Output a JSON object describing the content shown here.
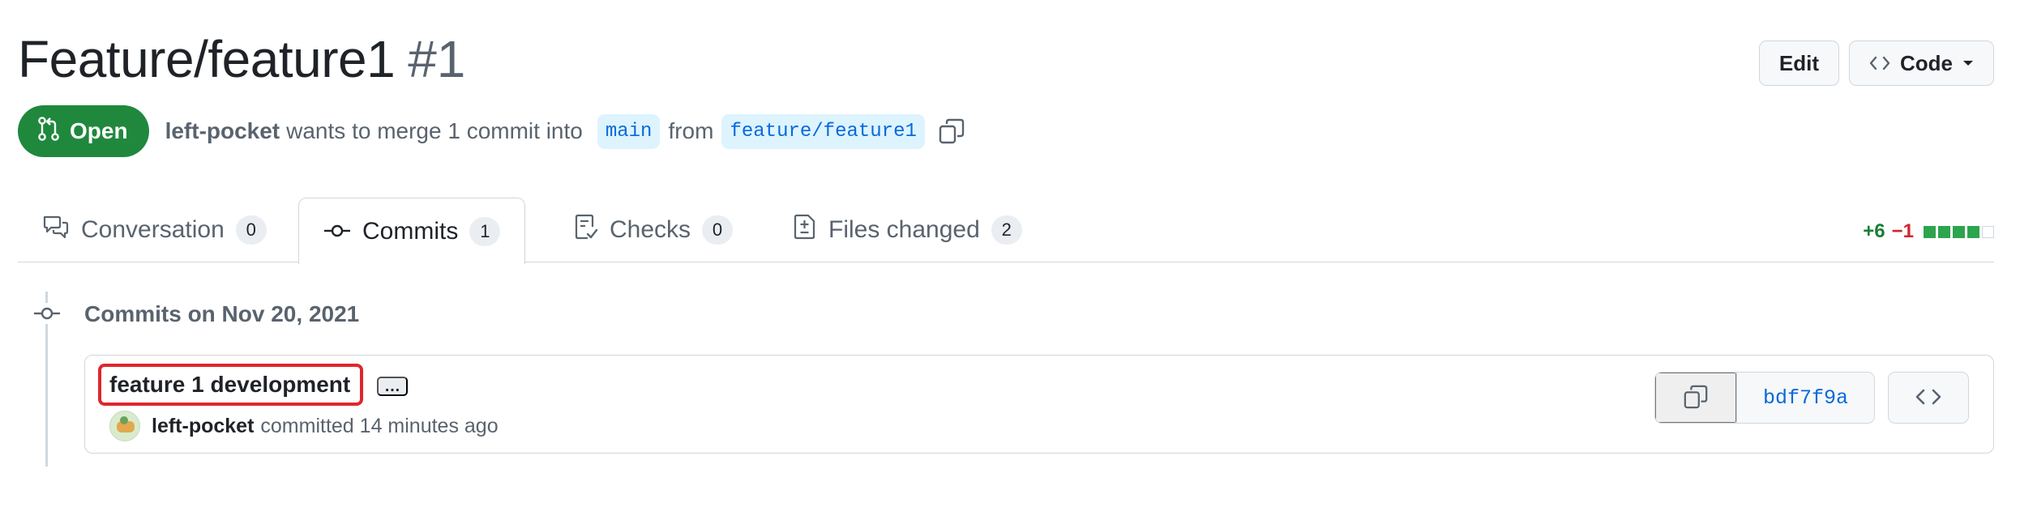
{
  "pull_request": {
    "title": "Feature/feature1",
    "number": "#1",
    "state": "Open",
    "author": "left-pocket",
    "merge_text": "wants to merge 1 commit into",
    "base_branch": "main",
    "from_text": "from",
    "head_branch": "feature/feature1"
  },
  "header_actions": {
    "edit_label": "Edit",
    "code_label": "Code"
  },
  "tabs": [
    {
      "label": "Conversation",
      "count": "0",
      "icon": "comment-discussion-icon"
    },
    {
      "label": "Commits",
      "count": "1",
      "icon": "git-commit-icon",
      "selected": true
    },
    {
      "label": "Checks",
      "count": "0",
      "icon": "checklist-icon"
    },
    {
      "label": "Files changed",
      "count": "2",
      "icon": "file-diff-icon"
    }
  ],
  "diffstat": {
    "additions": "+6",
    "deletions": "−1",
    "blocks": [
      "green",
      "green",
      "green",
      "green",
      "neutral"
    ]
  },
  "commit_group": {
    "heading": "Commits on Nov 20, 2021",
    "commits": [
      {
        "message": "feature 1 development",
        "ellipsis": "…",
        "author": "left-pocket",
        "action": "committed 14 minutes ago",
        "sha": "bdf7f9a"
      }
    ]
  },
  "colors": {
    "open_green": "#1f883d",
    "link_blue": "#0969da",
    "highlight_red": "#e0262c"
  }
}
